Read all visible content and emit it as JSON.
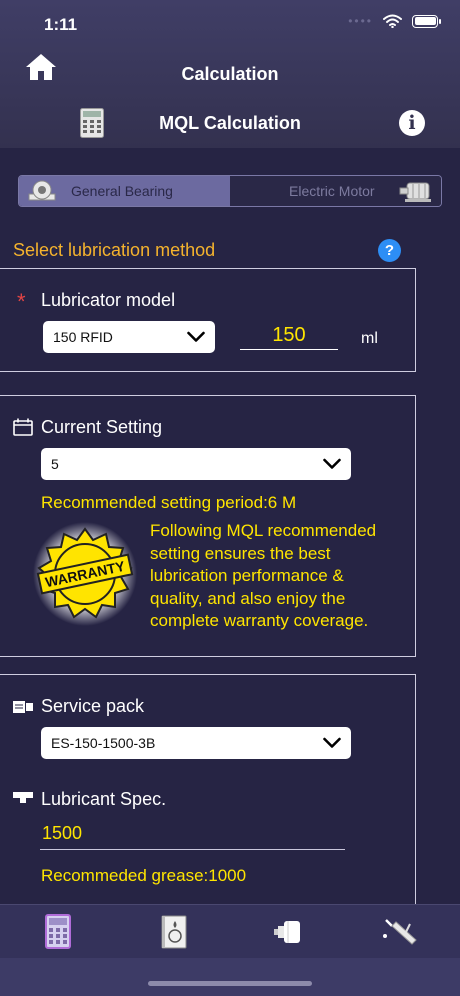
{
  "status_bar": {
    "time": "1:11"
  },
  "header": {
    "title": "Calculation",
    "subtitle": "MQL Calculation"
  },
  "segments": [
    {
      "label": "General Bearing",
      "active": true
    },
    {
      "label": "Electric Motor",
      "active": false
    }
  ],
  "section": {
    "title": "Select lubrication method"
  },
  "lubricator": {
    "required_mark": "*",
    "label": "Lubricator model",
    "model_value": "150 RFID",
    "volume_value": "150",
    "unit": "ml"
  },
  "current_setting": {
    "label": "Current Setting",
    "value": "5",
    "recommended": "Recommended setting period:6 M",
    "badge_text": "WARRANTY",
    "note": "Following MQL recommended setting ensures the best lubrication performance & quality, and also enjoy the complete warranty coverage."
  },
  "service": {
    "label": "Service pack",
    "value": "ES-150-1500-3B",
    "spec_label": "Lubricant Spec.",
    "spec_value": "1500",
    "recommended_grease": "Recommeded grease:1000"
  },
  "icons": {
    "home": "home-icon",
    "calculator": "calculator-icon",
    "info": "info-icon",
    "help": "help-icon",
    "calendar": "calendar-icon",
    "pack": "service-pack-icon",
    "spec": "lubricant-spec-icon",
    "bearing": "bearing-icon",
    "motor": "motor-icon"
  },
  "colors": {
    "background": "#262444",
    "accent_yellow": "#ffe500",
    "section_orange": "#f5b32d",
    "required_red": "#e44545",
    "help_blue": "#2d8ef5"
  }
}
